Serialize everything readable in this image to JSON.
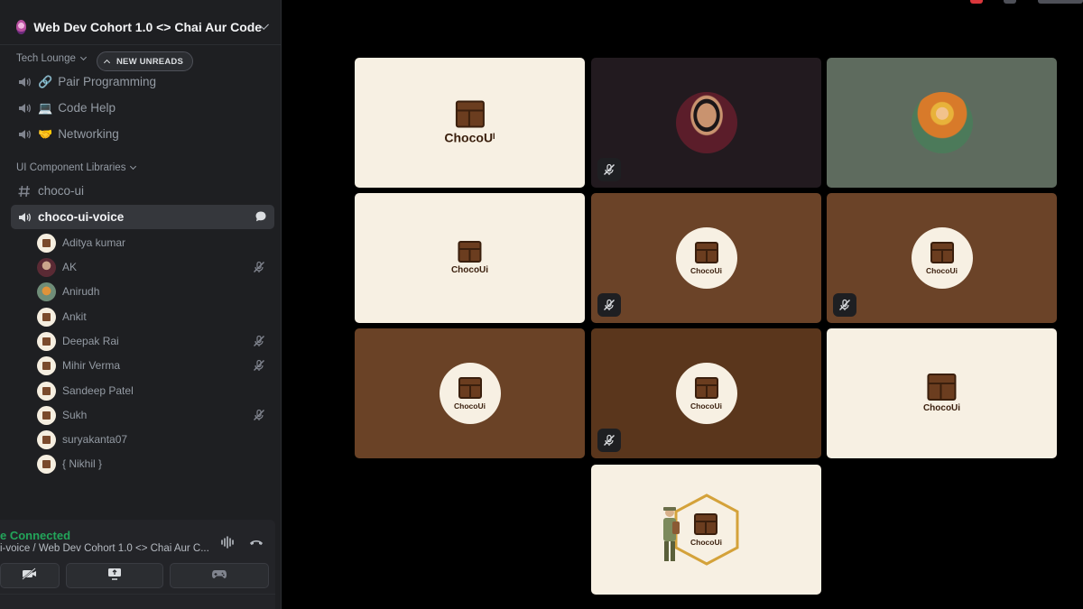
{
  "server": {
    "name": "Web Dev Cohort 1.0 <> Chai Aur Code"
  },
  "categories": {
    "tech_lounge": "Tech Lounge",
    "new_unreads": "NEW UNREADS",
    "ui_component_libraries": "UI Component Libraries"
  },
  "channels": [
    {
      "name": "Pair Programming",
      "emoji": "🔗"
    },
    {
      "name": "Code Help",
      "emoji": "💻"
    },
    {
      "name": "Networking",
      "emoji": "🤝"
    },
    {
      "name": "choco-ui"
    },
    {
      "name": "choco-ui-voice"
    }
  ],
  "members": [
    {
      "name": "Aditya kumar",
      "muted": false
    },
    {
      "name": "AK",
      "muted": true
    },
    {
      "name": "Anirudh",
      "muted": false
    },
    {
      "name": "Ankit",
      "muted": false
    },
    {
      "name": "Deepak Rai",
      "muted": true
    },
    {
      "name": "Mihir Verma",
      "muted": true
    },
    {
      "name": "Sandeep Patel",
      "muted": false
    },
    {
      "name": "Sukh",
      "muted": true
    },
    {
      "name": "suryakanta07",
      "muted": false
    },
    {
      "name": "{ Nikhil }",
      "muted": false
    }
  ],
  "voice": {
    "status": "e Connected",
    "location": "i-voice / Web Dev Cohort 1.0 <> Chai Aur C..."
  },
  "tiles": {
    "brand": "ChocoUi",
    "brand_first": "ChocoUᴵ"
  },
  "colors": {
    "sidebar": "#1e1f22",
    "connected": "#23a55a",
    "cream": "#f7f0e3",
    "brown": "#6b4328"
  }
}
